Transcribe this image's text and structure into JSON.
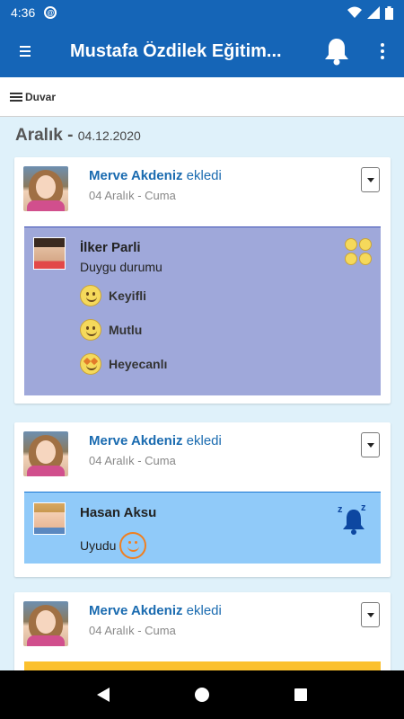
{
  "status_bar": {
    "time": "4:36"
  },
  "app_bar": {
    "title": "Mustafa Özdilek Eğitim..."
  },
  "sub_bar": {
    "label": "Duvar"
  },
  "date_header": {
    "month": "Aralık - ",
    "date": "04.12.2020"
  },
  "posts": [
    {
      "poster_name": "Merve Akdeniz",
      "poster_verb": " ekledi",
      "date": "04 Aralık - Cuma",
      "child_name": "İlker Parli",
      "title": "Duygu durumu",
      "moods": [
        "Keyifli",
        "Mutlu",
        "Heyecanlı"
      ]
    },
    {
      "poster_name": "Merve Akdeniz",
      "poster_verb": " ekledi",
      "date": "04 Aralık - Cuma",
      "child_name": "Hasan Aksu",
      "status": "Uyudu"
    },
    {
      "poster_name": "Merve Akdeniz",
      "poster_verb": " ekledi",
      "date": "04 Aralık - Cuma"
    }
  ],
  "colors": {
    "primary": "#1565b7",
    "mood_panel": "#9fa8da",
    "sleep_panel": "#90caf9",
    "accent_yellow": "#fbc02d"
  }
}
